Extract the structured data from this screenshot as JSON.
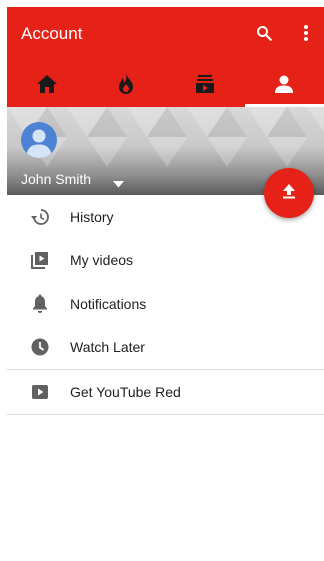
{
  "appbar": {
    "title": "Account",
    "search_icon": "search-icon",
    "more_icon": "more-vert-icon"
  },
  "tabs": [
    {
      "icon": "home-icon",
      "active": false
    },
    {
      "icon": "trending-icon",
      "active": false
    },
    {
      "icon": "subscriptions-icon",
      "active": false
    },
    {
      "icon": "account-icon",
      "active": true
    }
  ],
  "profile": {
    "name": "John Smith",
    "avatar_color": "#4e82d4"
  },
  "fab": {
    "icon": "upload-icon"
  },
  "menu": {
    "items": [
      {
        "label": "History",
        "icon": "history-icon"
      },
      {
        "label": "My videos",
        "icon": "my-videos-icon"
      },
      {
        "label": "Notifications",
        "icon": "bell-icon"
      },
      {
        "label": "Watch Later",
        "icon": "clock-icon"
      }
    ],
    "extra": {
      "label": "Get YouTube Red",
      "icon": "play-icon"
    }
  },
  "colors": {
    "accent": "#e62117",
    "text": "#212121",
    "icon": "#616161"
  }
}
